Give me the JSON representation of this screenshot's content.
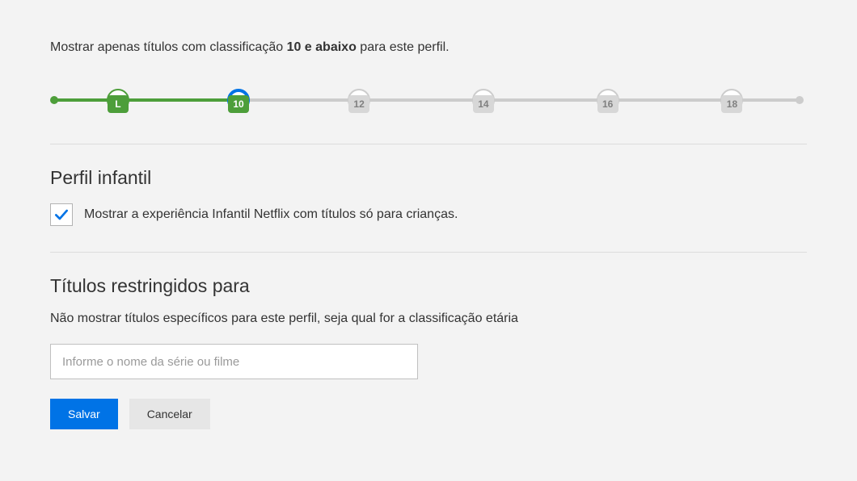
{
  "rating_description": {
    "prefix": "Mostrar apenas títulos com classificação ",
    "bold": "10 e abaixo",
    "suffix": " para este perfil."
  },
  "slider": {
    "start_percent": 0,
    "active_percent": 25,
    "steps": [
      {
        "pos": 9,
        "label": "L",
        "state": "active-border"
      },
      {
        "pos": 25,
        "label": "10",
        "state": "selected"
      },
      {
        "pos": 41,
        "label": "12",
        "state": ""
      },
      {
        "pos": 57.5,
        "label": "14",
        "state": ""
      },
      {
        "pos": 74,
        "label": "16",
        "state": ""
      },
      {
        "pos": 90.5,
        "label": "18",
        "state": ""
      }
    ],
    "label_colors": [
      "green",
      "green",
      "gray",
      "gray",
      "gray",
      "gray"
    ]
  },
  "kids": {
    "heading": "Perfil infantil",
    "checkbox_checked": true,
    "checkbox_label": "Mostrar a experiência Infantil Netflix com títulos só para crianças."
  },
  "restricted": {
    "heading": "Títulos restringidos para",
    "description": "Não mostrar títulos específicos para este perfil, seja qual for a classificação etária",
    "placeholder": "Informe o nome da série ou filme"
  },
  "buttons": {
    "save": "Salvar",
    "cancel": "Cancelar"
  }
}
